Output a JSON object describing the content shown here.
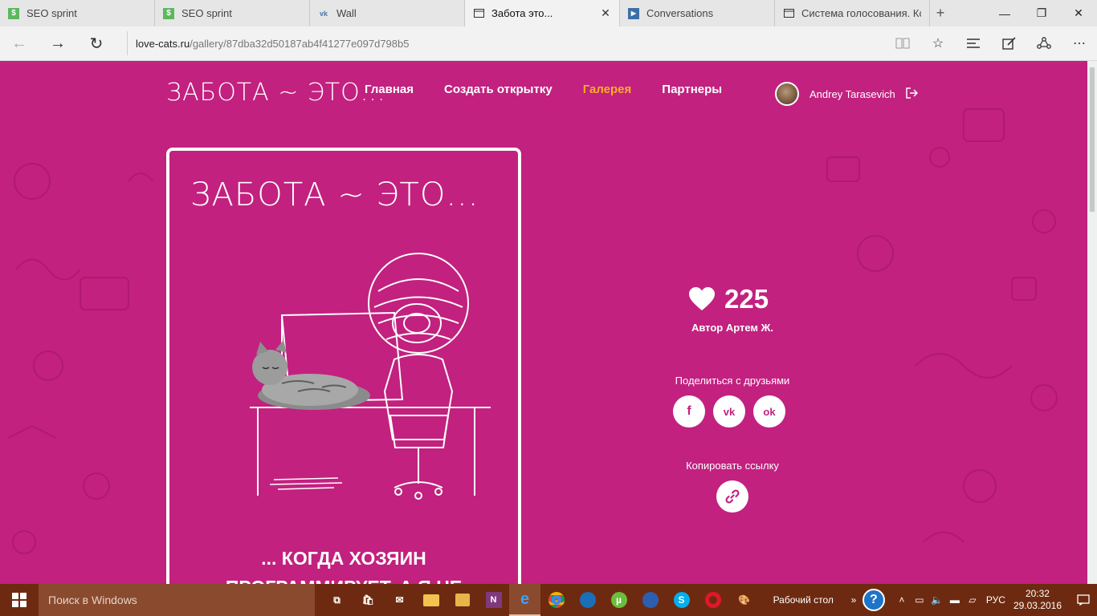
{
  "tabs": [
    {
      "title": "SEO sprint",
      "icon": "seo-sprint-icon",
      "active": false,
      "closable": false
    },
    {
      "title": "SEO sprint",
      "icon": "seo-sprint-icon",
      "active": false,
      "closable": false
    },
    {
      "title": "Wall",
      "icon": "vk-icon",
      "active": false,
      "closable": false
    },
    {
      "title": "Забота это...",
      "icon": "page-icon",
      "active": true,
      "closable": true
    },
    {
      "title": "Conversations",
      "icon": "conversations-icon",
      "active": false,
      "closable": false
    },
    {
      "title": "Система голосования. Кон",
      "icon": "page-icon",
      "active": false,
      "closable": false
    }
  ],
  "address": {
    "host": "love-cats.ru",
    "path": "/gallery/87dba32d50187ab4f41277e097d798b5"
  },
  "site": {
    "logo": "ЗАБОТА ~ ЭТО...",
    "nav": [
      {
        "label": "Главная",
        "active": false
      },
      {
        "label": "Создать открытку",
        "active": false
      },
      {
        "label": "Галерея",
        "active": true
      },
      {
        "label": "Партнеры",
        "active": false
      }
    ],
    "user_name": "Andrey Tarasevich"
  },
  "card": {
    "title": "ЗАБОТА ~ ЭТО...",
    "caption_line1": "... КОГДА ХОЗЯИН",
    "caption_line2": "ПРОГРАММИРУЕТ, А Я НЕ"
  },
  "details": {
    "likes": "225",
    "author": "Автор Артем Ж.",
    "share_label": "Поделиться с друзьями",
    "copy_label": "Копировать ссылку",
    "social": [
      {
        "name": "facebook",
        "glyph": "f"
      },
      {
        "name": "vkontakte",
        "glyph": "vk"
      },
      {
        "name": "odnoklassniki",
        "glyph": "ok"
      }
    ]
  },
  "taskbar": {
    "search_placeholder": "Поиск в Windows",
    "desktop_label": "Рабочий стол",
    "lang": "РУС",
    "time": "20:32",
    "date": "29.03.2016"
  },
  "colors": {
    "page_bg": "#c2217f",
    "nav_active": "#f6b021",
    "taskbar": "#6e2a10"
  }
}
